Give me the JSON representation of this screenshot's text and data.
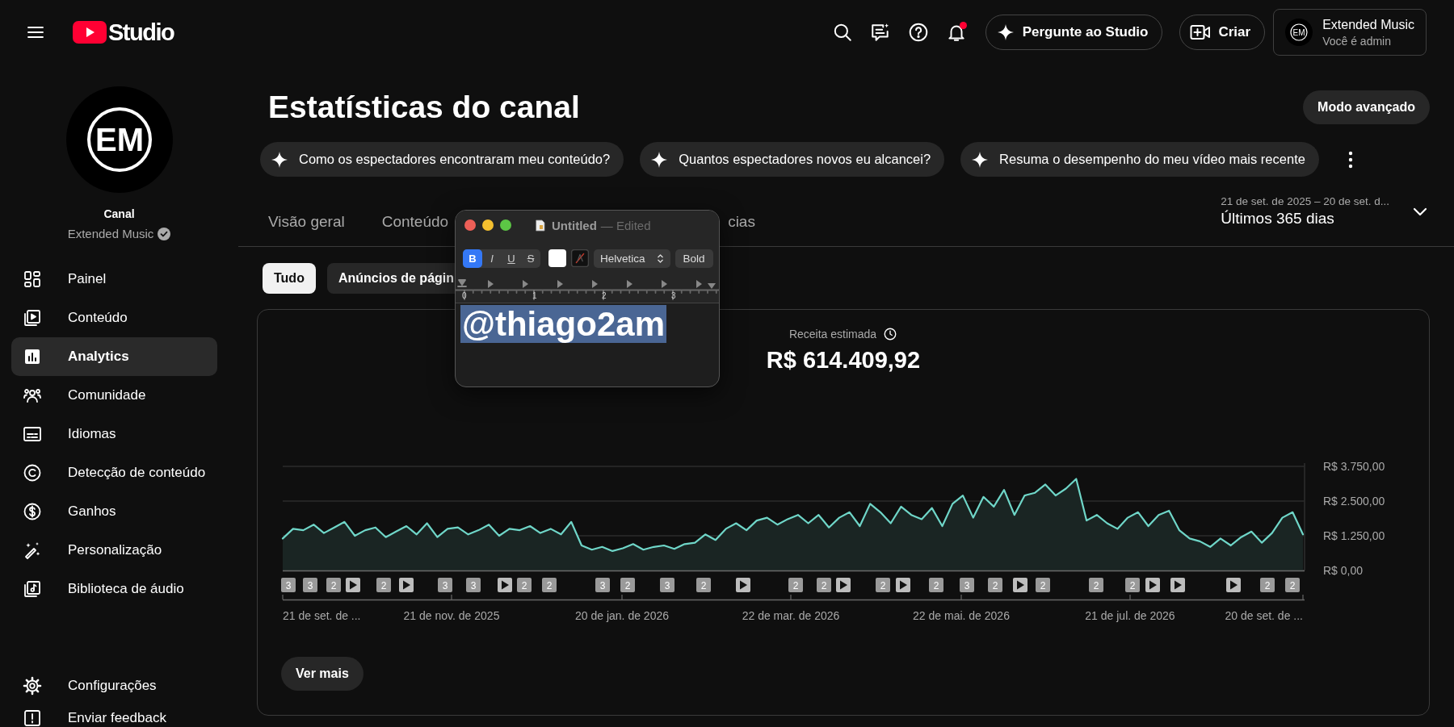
{
  "topbar": {
    "logo_text": "Studio",
    "ask_button": "Pergunte ao Studio",
    "create_button": "Criar",
    "notifications": {
      "unread": true
    },
    "account": {
      "avatar_text": "EM",
      "name": "Extended Music",
      "role": "Você é admin"
    }
  },
  "sidebar": {
    "channel": {
      "avatar_text": "EM",
      "heading": "Canal",
      "name": "Extended Music",
      "verified": true
    },
    "nav": [
      {
        "label": "Painel",
        "selected": false
      },
      {
        "label": "Conteúdo",
        "selected": false
      },
      {
        "label": "Analytics",
        "selected": true
      },
      {
        "label": "Comunidade",
        "selected": false
      },
      {
        "label": "Idiomas",
        "selected": false
      },
      {
        "label": "Detecção de conteúdo",
        "selected": false
      },
      {
        "label": "Ganhos",
        "selected": false
      },
      {
        "label": "Personalização",
        "selected": false
      },
      {
        "label": "Biblioteca de áudio",
        "selected": false
      }
    ],
    "footer_nav": [
      {
        "label": "Configurações"
      },
      {
        "label": "Enviar feedback"
      }
    ]
  },
  "page": {
    "title": "Estatísticas do canal",
    "advanced_button": "Modo avançado",
    "suggestions": [
      "Como os espectadores encontraram meu conteúdo?",
      "Quantos espectadores novos eu alcancei?",
      "Resuma o desempenho do meu vídeo mais recente"
    ],
    "tabs": [
      {
        "label": "Visão geral",
        "selected": false
      },
      {
        "label": "Conteúdo",
        "selected": false
      },
      {
        "label": "cias",
        "selected": false
      }
    ],
    "period": {
      "range": "21 de set. de 2025 – 20 de set. d...",
      "label": "Últimos 365 dias"
    },
    "filters": [
      {
        "label": "Tudo",
        "selected": true
      },
      {
        "label": "Anúncios de págin",
        "selected": false
      }
    ],
    "metric_card": {
      "label": "Receita estimada",
      "value": "R$ 614.409,92",
      "more_button": "Ver mais",
      "y_axis_labels": [
        "R$ 3.750,00",
        "R$ 2.500,00",
        "R$ 1.250,00",
        "R$ 0,00"
      ],
      "x_axis_labels": [
        "21 de set. de ...",
        "21 de nov. de 2025",
        "20 de jan. de 2026",
        "22 de mar. de 2026",
        "22 de mai. de 2026",
        "21 de jul. de 2026",
        "20 de set. de ..."
      ],
      "event_markers": [
        {
          "kind": "count",
          "label": "3"
        },
        {
          "kind": "count",
          "label": "3"
        },
        {
          "kind": "count",
          "label": "2"
        },
        {
          "kind": "video"
        },
        {
          "kind": "count",
          "label": "2"
        },
        {
          "kind": "video"
        },
        {
          "kind": "count",
          "label": "3"
        },
        {
          "kind": "count",
          "label": "3"
        },
        {
          "kind": "video"
        },
        {
          "kind": "count",
          "label": "2"
        },
        {
          "kind": "count",
          "label": "2"
        },
        {
          "kind": "count",
          "label": "3"
        },
        {
          "kind": "count",
          "label": "2"
        },
        {
          "kind": "count",
          "label": "3"
        },
        {
          "kind": "count",
          "label": "2"
        },
        {
          "kind": "video"
        },
        {
          "kind": "count",
          "label": "2"
        },
        {
          "kind": "count",
          "label": "2"
        },
        {
          "kind": "video"
        },
        {
          "kind": "count",
          "label": "2"
        },
        {
          "kind": "video"
        },
        {
          "kind": "count",
          "label": "2"
        },
        {
          "kind": "count",
          "label": "3"
        },
        {
          "kind": "count",
          "label": "2"
        },
        {
          "kind": "video"
        },
        {
          "kind": "count",
          "label": "2"
        },
        {
          "kind": "count",
          "label": "2"
        },
        {
          "kind": "count",
          "label": "2"
        },
        {
          "kind": "video"
        },
        {
          "kind": "video"
        },
        {
          "kind": "video"
        },
        {
          "kind": "count",
          "label": "2"
        },
        {
          "kind": "count",
          "label": "2"
        }
      ]
    }
  },
  "text_editor": {
    "title": "Untitled",
    "status": "— Edited",
    "format_buttons": [
      {
        "label": "B",
        "selected": true
      },
      {
        "label": "I",
        "selected": false
      },
      {
        "label": "U",
        "selected": false
      },
      {
        "label": "S",
        "selected": false
      }
    ],
    "font": "Helvetica",
    "style": "Bold",
    "ruler_labels": [
      "0",
      "1",
      "2",
      "3"
    ],
    "document_text": "@thiago2am",
    "text_selected": true
  }
}
